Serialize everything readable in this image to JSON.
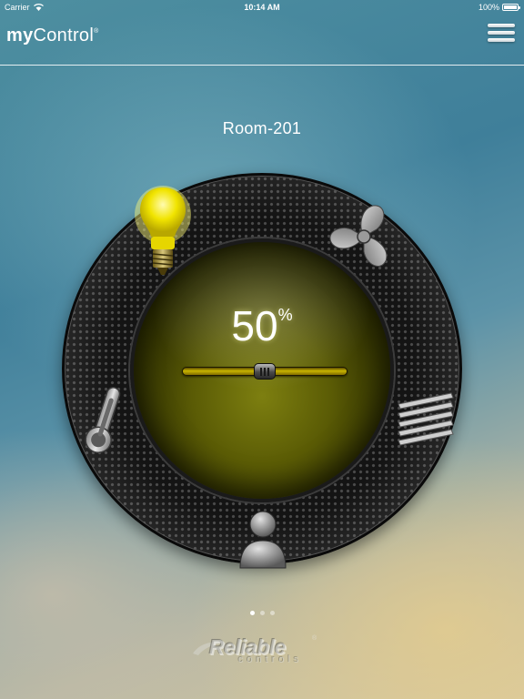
{
  "status_bar": {
    "carrier": "Carrier",
    "time": "10:14 AM",
    "battery": "100%"
  },
  "header": {
    "app_name_bold": "my",
    "app_name_regular": "Control",
    "app_name_mark": "®",
    "menu_icon": "hamburger-menu-icon"
  },
  "room": {
    "name": "Room-201"
  },
  "dial": {
    "level_value": "50",
    "level_unit": "%",
    "level_fraction": 0.5,
    "accent_color": "#c9b400",
    "icons": [
      "lightbulb-icon",
      "fan-icon",
      "blinds-icon",
      "thermometer-icon",
      "occupant-icon"
    ]
  },
  "pager": {
    "page_count": 3,
    "active_page": 1
  },
  "brand": {
    "name": "Reliable",
    "sub": "controls",
    "mark": "®"
  }
}
